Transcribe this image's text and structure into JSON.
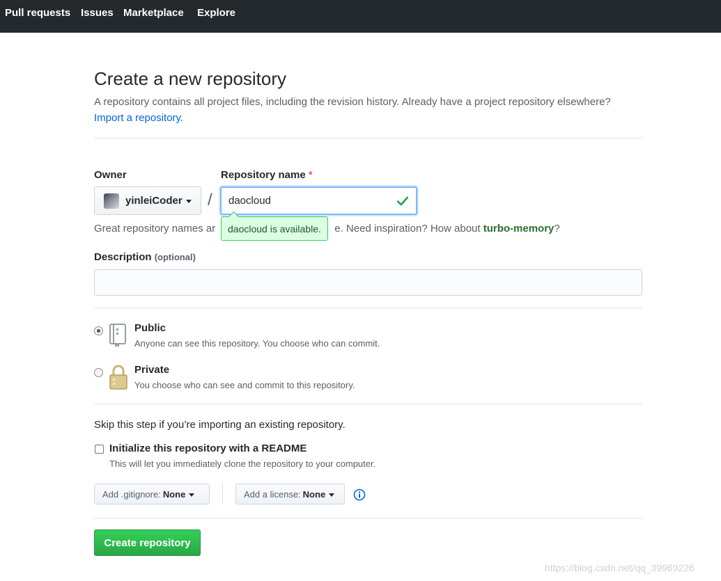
{
  "nav": {
    "items": [
      "Pull requests",
      "Issues",
      "Marketplace",
      "Explore"
    ]
  },
  "page": {
    "title": "Create a new repository",
    "description": "A repository contains all project files, including the revision history. Already have a project repository elsewhere?",
    "import_link": "Import a repository."
  },
  "owner": {
    "label": "Owner",
    "value": "yinleiCoder"
  },
  "repo": {
    "label": "Repository name",
    "required_mark": "*",
    "value": "daocloud",
    "available_tooltip": "daocloud is available."
  },
  "hint": {
    "prefix": "Great repository names ar",
    "suffix": "e. Need inspiration? How about ",
    "suggestion": "turbo-memory",
    "end": "?"
  },
  "description_field": {
    "label": "Description",
    "optional": "(optional)",
    "value": ""
  },
  "visibility": {
    "public_title": "Public",
    "public_note": "Anyone can see this repository. You choose who can commit.",
    "private_title": "Private",
    "private_note": "You choose who can see and commit to this repository.",
    "selected": "Public"
  },
  "init": {
    "skip_text": "Skip this step if you’re importing an existing repository.",
    "readme_label": "Initialize this repository with a README",
    "readme_note": "This will let you immediately clone the repository to your computer.",
    "readme_checked": false
  },
  "dropdowns": {
    "gitignore_prefix": "Add .gitignore:",
    "gitignore_value": "None",
    "license_prefix": "Add a license:",
    "license_value": "None"
  },
  "submit_label": "Create repository",
  "watermark": "https://blog.csdn.net/qq_39969226",
  "colors": {
    "nav_bg": "#24292e",
    "link": "#0366d6",
    "primary_button": "#28a745",
    "focus_border": "#79b8ff",
    "available_bg": "#dcffe4"
  }
}
